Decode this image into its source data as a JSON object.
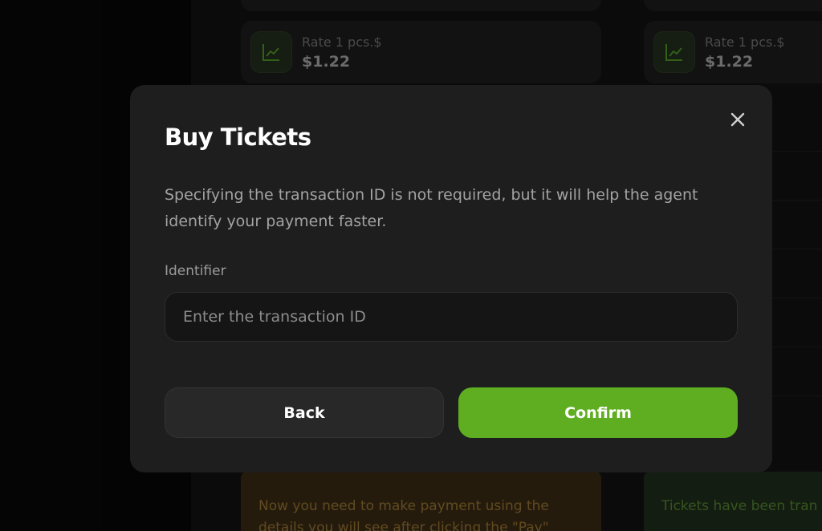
{
  "background": {
    "rate_cards": [
      {
        "label": "Rate 1 pcs.$",
        "value": "$1.22",
        "icon": "chart-line-icon"
      },
      {
        "label": "Rate 1 pcs.$",
        "value": "$1.22",
        "icon": "chart-line-icon"
      }
    ],
    "payment_note": "Now you need to make payment using the details you will see after clicking the \"Pay\"",
    "success_note": "Tickets have been tran status. They will be up"
  },
  "modal": {
    "title": "Buy Tickets",
    "description": "Specifying the transaction ID is not required, but it will help the agent identify your payment faster.",
    "field_label": "Identifier",
    "input_value": "",
    "input_placeholder": "Enter the transaction ID",
    "back_label": "Back",
    "confirm_label": "Confirm",
    "close_icon": "close-icon"
  },
  "colors": {
    "accent_green": "#5fae21",
    "modal_bg": "#1e1e1e",
    "page_bg": "#070707"
  }
}
